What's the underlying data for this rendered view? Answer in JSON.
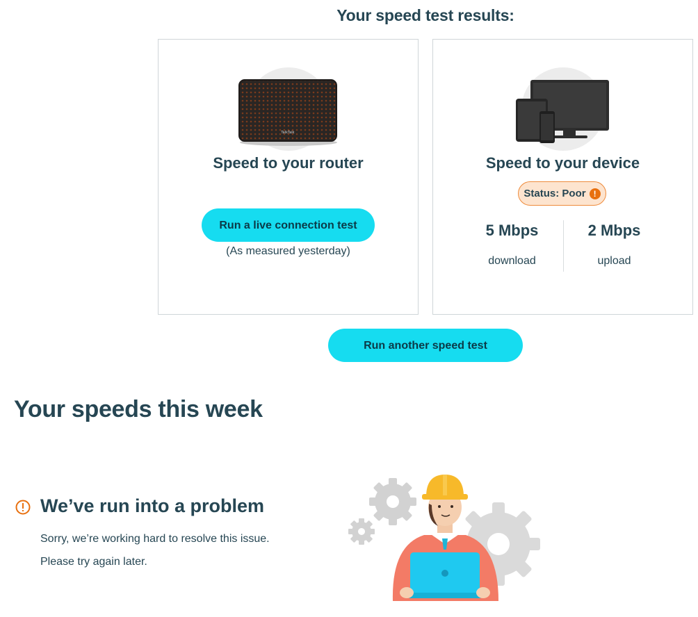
{
  "results_title": "Your speed test results:",
  "router_card": {
    "title": "Speed to your router",
    "live_button": "Run a live connection test",
    "measured_note": "(As measured yesterday)",
    "device_brand": "TalkTalk"
  },
  "device_card": {
    "title": "Speed to your device",
    "status_label": "Status: Poor",
    "status_icon": "!",
    "download_value": "5 Mbps",
    "download_label": "download",
    "upload_value": "2 Mbps",
    "upload_label": "upload"
  },
  "run_another_button": "Run another speed test",
  "week_title": "Your speeds this week",
  "problem": {
    "title": "We’ve run into a problem",
    "line1": "Sorry, we’re working hard to resolve this issue.",
    "line2": "Please try again later."
  },
  "colors": {
    "accent": "#16dcf0",
    "heading": "#264653",
    "warning": "#e8700f",
    "status_bg": "#fde4cf"
  }
}
